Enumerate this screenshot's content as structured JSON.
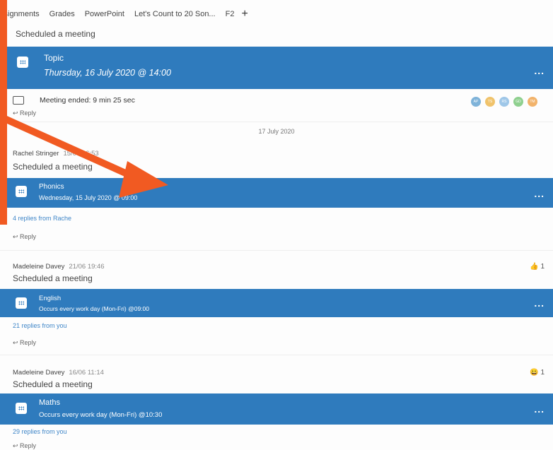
{
  "tabs": [
    "ssignments",
    "Grades",
    "PowerPoint",
    "Let's Count to 20 Son...",
    "F2"
  ],
  "add_tab": "+",
  "posts": [
    {
      "scheduled_text": "Scheduled a meeting",
      "meeting_title": "Topic",
      "meeting_date": "Thursday, 16 July 2020 @ 14:00",
      "ended_text": "Meeting ended: 9 min 25 sec",
      "avatars": [
        "AP",
        "TS",
        "RS",
        "GD",
        "TM"
      ],
      "reply": "Reply"
    },
    {
      "author": "Rachel Stringer",
      "time": "15/07 16:53",
      "scheduled_text": "Scheduled a meeting",
      "meeting_title": "Phonics",
      "meeting_date": "Wednesday, 15 July 2020 @ 09:00",
      "replies_link": "4 replies from Rache",
      "reply": "Reply"
    },
    {
      "author": "Madeleine Davey",
      "time": "21/06 19:46",
      "scheduled_text": "Scheduled a meeting",
      "meeting_title": "English",
      "meeting_date": "Occurs every work day (Mon-Fri) @09:00",
      "replies_link": "21 replies from you",
      "reply": "Reply",
      "reaction_count": "1"
    },
    {
      "author": "Madeleine Davey",
      "time": "16/06 11:14",
      "scheduled_text": "Scheduled a meeting",
      "meeting_title": "Maths",
      "meeting_date": "Occurs every work day (Mon-Fri) @10:30",
      "replies_link": "29 replies from you",
      "reply": "Reply",
      "reaction_count": "1"
    }
  ],
  "date_divider": "17 July 2020",
  "more_label": "...",
  "colors": {
    "card_blue": "#2f7bbd",
    "arrow_orange": "#f15a22",
    "link_blue": "#3f86c8"
  }
}
